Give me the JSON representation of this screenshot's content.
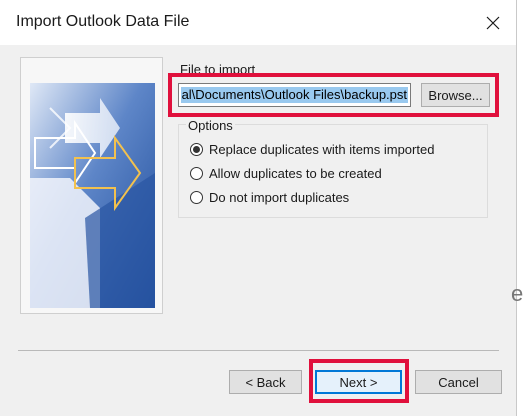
{
  "window": {
    "title": "Import Outlook Data File",
    "close_icon": "close-icon"
  },
  "file_section": {
    "label": "File to import",
    "value": "al\\Documents\\Outlook Files\\backup.pst",
    "browse_label": "Browse..."
  },
  "options": {
    "legend": "Options",
    "items": [
      {
        "label": "Replace duplicates with items imported",
        "checked": true
      },
      {
        "label": "Allow duplicates to be created",
        "checked": false
      },
      {
        "label": "Do not import duplicates",
        "checked": false
      }
    ]
  },
  "buttons": {
    "back": "< Back",
    "next": "Next >",
    "cancel": "Cancel"
  },
  "background": {
    "partial_glyph": "e"
  },
  "colors": {
    "highlight": "#e0103c",
    "focus": "#0078d7",
    "selection": "#99c9ef"
  }
}
